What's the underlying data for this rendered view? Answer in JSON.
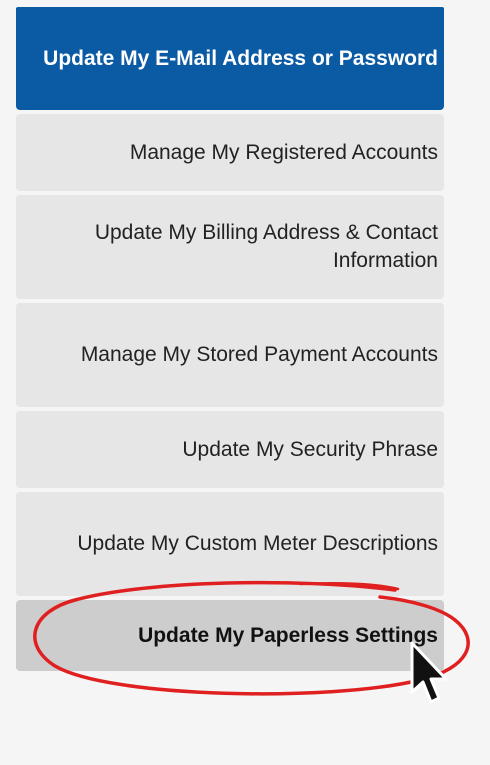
{
  "menu": {
    "items": [
      {
        "label": "Update My E-Mail Address or Password",
        "state": "active"
      },
      {
        "label": "Manage My Registered Accounts",
        "state": "normal"
      },
      {
        "label": "Update My Billing Address & Contact Information",
        "state": "normal"
      },
      {
        "label": "Manage My Stored Payment Accounts",
        "state": "normal"
      },
      {
        "label": "Update My Security Phrase",
        "state": "normal"
      },
      {
        "label": "Update My Custom Meter Descriptions",
        "state": "normal"
      },
      {
        "label": "Update My Paperless Settings",
        "state": "hovered"
      }
    ]
  },
  "colors": {
    "active_background": "#0b5aa4",
    "item_background": "#e6e6e6",
    "hover_background": "#cdcdcd",
    "annotation_circle": "#e02020"
  },
  "icons": {
    "cursor": "arrow-pointer-icon",
    "annotation": "red-circle-annotation"
  }
}
